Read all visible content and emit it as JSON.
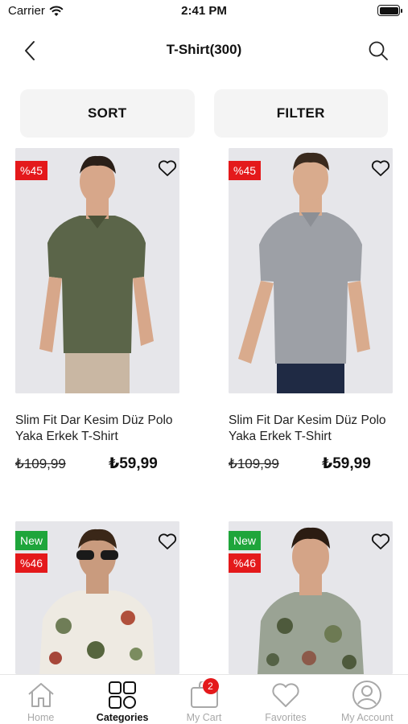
{
  "status": {
    "carrier": "Carrier",
    "time": "2:41 PM"
  },
  "header": {
    "title": "T-Shirt(300)"
  },
  "actions": {
    "sort_label": "SORT",
    "filter_label": "FILTER"
  },
  "products": [
    {
      "badges": [
        "%45"
      ],
      "name": "Slim Fit Dar Kesim Düz Polo Yaka Erkek T-Shirt",
      "old_price": "₺109,99",
      "price": "₺59,99",
      "shirt_color": "#5b6549"
    },
    {
      "badges": [
        "%45"
      ],
      "name": "Slim Fit Dar Kesim Düz Polo Yaka Erkek T-Shirt",
      "old_price": "₺109,99",
      "price": "₺59,99",
      "shirt_color": "#9da0a6"
    },
    {
      "badges": [
        "New",
        "%46"
      ],
      "name": "",
      "old_price": "",
      "price": "",
      "shirt_color": "#eeeae2"
    },
    {
      "badges": [
        "New",
        "%46"
      ],
      "name": "",
      "old_price": "",
      "price": "",
      "shirt_color": "#9aa394"
    }
  ],
  "tabbar": {
    "items": [
      {
        "label": "Home",
        "icon": "home-icon"
      },
      {
        "label": "Categories",
        "icon": "grid-icon"
      },
      {
        "label": "My Cart",
        "icon": "cart-icon",
        "badge": "2"
      },
      {
        "label": "Favorites",
        "icon": "heart-icon"
      },
      {
        "label": "My Account",
        "icon": "user-icon"
      }
    ],
    "active": "Categories"
  },
  "colors": {
    "sale_badge": "#e4191b",
    "new_badge": "#1fa53b",
    "inactive_tab": "#a8a8a8"
  }
}
